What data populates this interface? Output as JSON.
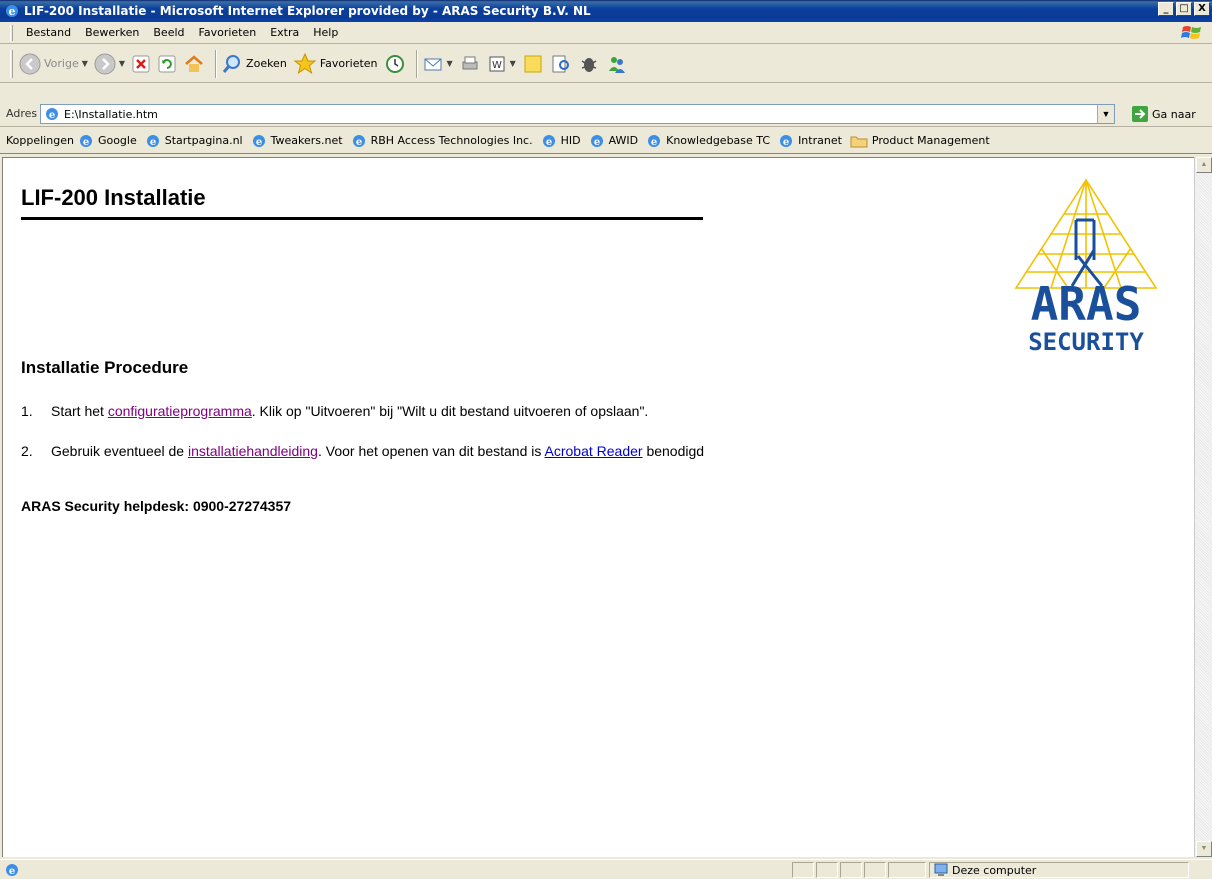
{
  "window": {
    "title": "LIF-200 Installatie - Microsoft Internet Explorer provided by - ARAS Security B.V. NL",
    "minimize": "_",
    "maximize": "□",
    "close": "X"
  },
  "menu": [
    "Bestand",
    "Bewerken",
    "Beeld",
    "Favorieten",
    "Extra",
    "Help"
  ],
  "toolbar": {
    "back_label": "Vorige",
    "search_label": "Zoeken",
    "favorites_label": "Favorieten"
  },
  "address": {
    "label": "Adres",
    "value": "E:\\Installatie.htm",
    "go_label": "Ga naar"
  },
  "links": {
    "label": "Koppelingen",
    "items": [
      "Google",
      "Startpagina.nl",
      "Tweakers.net",
      "RBH Access Technologies Inc.",
      "HID",
      "AWID",
      "Knowledgebase TC",
      "Intranet",
      "Product Management"
    ]
  },
  "page": {
    "title": "LIF-200 Installatie",
    "section_title": "Installatie Procedure",
    "step1": {
      "num": "1.",
      "pre": "Start het ",
      "link": "configuratieprogramma",
      "post": ".  Klik op \"Uitvoeren\"  bij \"Wilt u dit bestand uitvoeren of opslaan\"."
    },
    "step2": {
      "num": "2.",
      "pre": "Gebruik eventueel de ",
      "link": "installatiehandleiding",
      "mid": ". Voor het openen van dit bestand is ",
      "link2": "Acrobat Reader",
      "post": " benodigd"
    },
    "helpdesk": "ARAS Security helpdesk: 0900-27274357",
    "logo": {
      "line1": "ARAS",
      "line2": "SECURITY",
      "blue": "#1a4f9c",
      "yellow": "#f2c200"
    }
  },
  "status": {
    "zone": "Deze computer"
  }
}
